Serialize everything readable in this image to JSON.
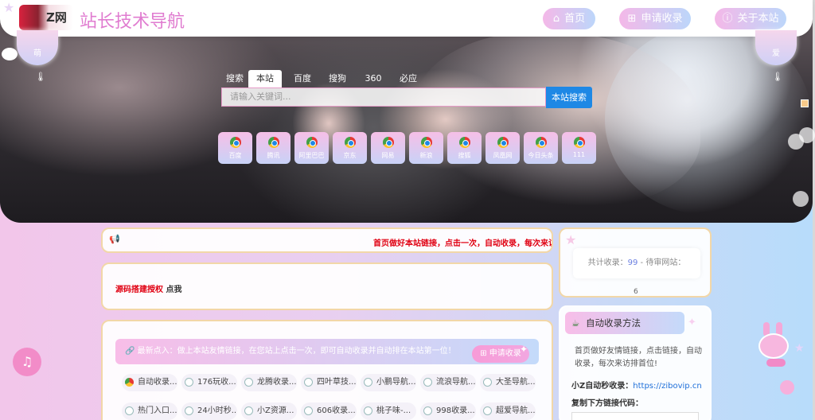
{
  "header": {
    "logo_text": "Z网",
    "title": "站长技术导航",
    "nav": [
      {
        "icon": "home-icon",
        "label": "首页"
      },
      {
        "icon": "plus-square-icon",
        "label": "申请收录"
      },
      {
        "icon": "info-circle-icon",
        "label": "关于本站"
      }
    ]
  },
  "side_bubbles": {
    "left": "萌",
    "right": "爱"
  },
  "search": {
    "tabs": [
      "搜索",
      "本站",
      "百度",
      "搜狗",
      "360",
      "必应"
    ],
    "active_tab": "本站",
    "placeholder": "请输入关键词...",
    "button": "本站搜索"
  },
  "quick_links": [
    "百度",
    "腾讯",
    "阿里巴巴",
    "京东",
    "网易",
    "新浪",
    "搜狐",
    "凤凰网",
    "今日头条",
    "111"
  ],
  "notice": {
    "icon": "megaphone-icon",
    "text": "首页做好本站链接，点击一次，自动收录，每次来访排"
  },
  "auth_card": {
    "highlight": "源码搭建授权",
    "link": "点我"
  },
  "main_nav": {
    "icon": "link-icon",
    "header": "最新点入：做上本站友情链接，在您站上点击一次，即可自动收录并自动排在本站第一位！",
    "apply_button": "申请收录",
    "sites": [
      "自动收录...",
      "176玩收...",
      "龙腾收录...",
      "四叶草技...",
      "小鹏导航...",
      "流浪导航...",
      "大圣导航...",
      "热门入口...",
      "24小时秒...",
      "小Z资源...",
      "606收录...",
      "桃子味-...",
      "998收录...",
      "超爱导航..."
    ]
  },
  "stats": {
    "label_total": "共计收录：",
    "total": "99",
    "sep": " - ",
    "label_pending": "待审网站：",
    "pending": "6"
  },
  "auto_collect": {
    "icon": "cup-icon",
    "title": "自动收录方法",
    "description": "首页做好友情链接，点击链接，自动收录，每次来访排首位!",
    "site_label": "小Z自动秒收录：",
    "site_url": "https://zibovip.cn",
    "code_label": "复制下方链接代码："
  },
  "colors": {
    "accent_pink": "#e07cd0",
    "search_button": "#1e88e5",
    "notice_red": "#e00012",
    "card_border": "#f2d7a8"
  }
}
